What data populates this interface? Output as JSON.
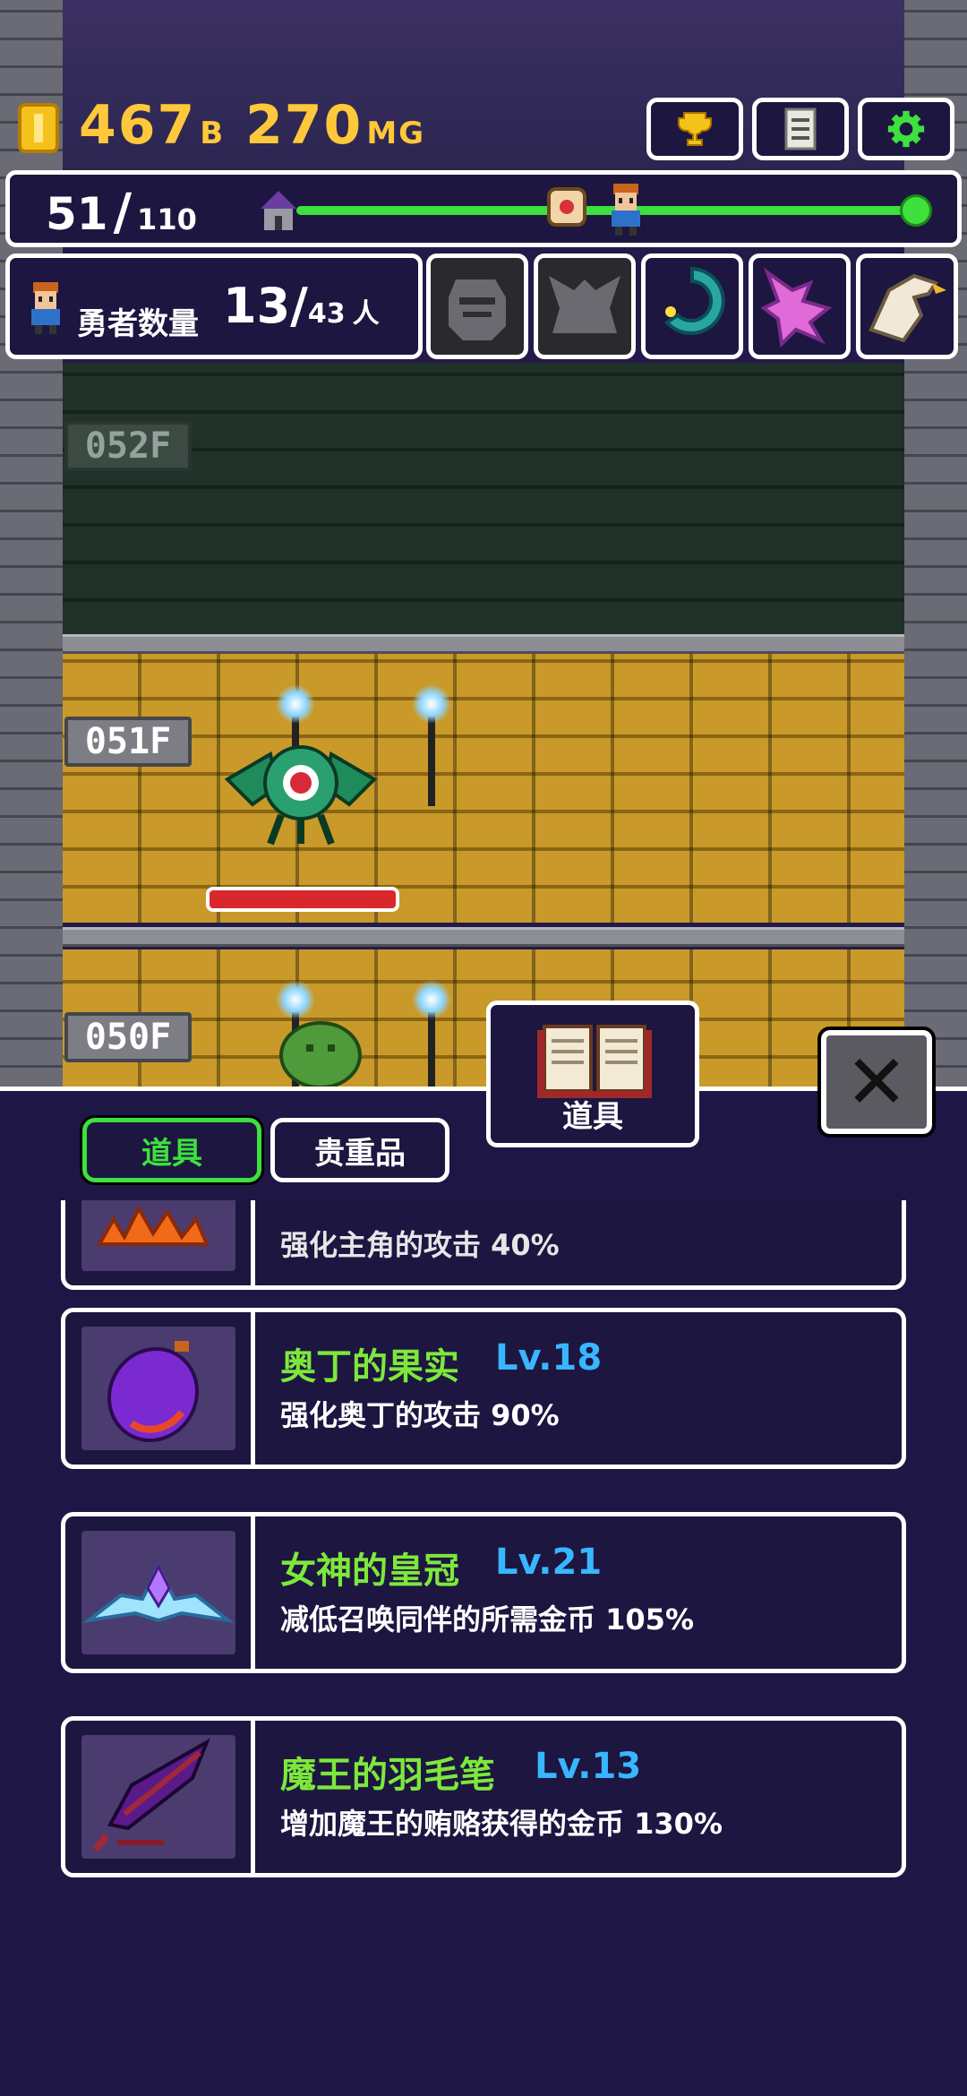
{
  "hud": {
    "gold_value": "467",
    "gold_unit1": "B",
    "gold_value2": "270",
    "gold_unit2": "MG",
    "floor_current": "51",
    "floor_separator": "/",
    "floor_max": "110",
    "hero_label": "勇者数量",
    "hero_current": "13",
    "hero_separator": "/",
    "hero_max": "43",
    "hero_unit": "人"
  },
  "floors": [
    {
      "label": "052F"
    },
    {
      "label": "051F"
    },
    {
      "label": "050F"
    }
  ],
  "monster_hp_fraction": 1.0,
  "tabs": {
    "book_label": "道具",
    "items_label": "道具",
    "valuables_label": "贵重品",
    "close_symbol": "✕"
  },
  "items": [
    {
      "name": "",
      "level": "",
      "desc": "强化主角的攻击 40%"
    },
    {
      "name": "奥丁的果实",
      "level": "Lv.18",
      "desc": "强化奥丁的攻击 90%"
    },
    {
      "name": "女神的皇冠",
      "level": "Lv.21",
      "desc": "减低召唤同伴的所需金币 105%"
    },
    {
      "name": "魔王的羽毛笔",
      "level": "Lv.13",
      "desc": "增加魔王的贿赂获得的金币 130%"
    }
  ],
  "colors": {
    "accent_green": "#3ee03e",
    "item_name": "#7de83b",
    "item_level": "#38b6ff",
    "gold_text": "#ffc83a",
    "panel_bg": "#1c1640"
  }
}
